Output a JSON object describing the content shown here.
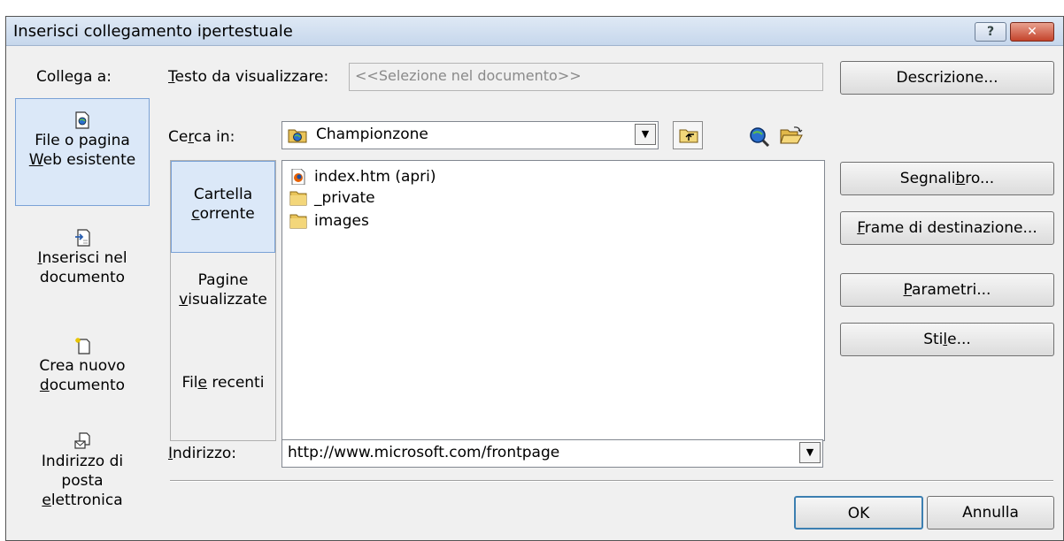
{
  "window": {
    "title": "Inserisci collegamento ipertestuale",
    "help_label": "?",
    "close_label": "✕"
  },
  "sidebar": {
    "heading": "Collega a:",
    "items": [
      {
        "line1": "File o pagina",
        "line2": "Web esistente",
        "line3": "",
        "icon": "web-page-icon",
        "active": true
      },
      {
        "line1": "Inserisci nel",
        "line2": "documento",
        "line3": "",
        "icon": "place-in-document-icon",
        "active": false
      },
      {
        "line1": "Crea nuovo",
        "line2": "documento",
        "line3": "",
        "icon": "new-document-icon",
        "active": false
      },
      {
        "line1": "Indirizzo di",
        "line2": "posta",
        "line3": "elettronica",
        "icon": "email-address-icon",
        "active": false
      }
    ]
  },
  "text_to_display": {
    "label": "Testo da visualizzare:",
    "value": "<<Selezione nel documento>>"
  },
  "look_in": {
    "label": "Cerca in:",
    "value": "Championzone"
  },
  "tabs": [
    {
      "line1": "Cartella",
      "line2": "corrente",
      "active": true
    },
    {
      "line1": "Pagine",
      "line2": "visualizzate",
      "active": false
    },
    {
      "line1": "File recenti",
      "line2": "",
      "active": false
    }
  ],
  "files": [
    {
      "name": "index.htm (apri)",
      "icon": "firefox-html-icon"
    },
    {
      "name": "_private",
      "icon": "folder-icon"
    },
    {
      "name": "images",
      "icon": "folder-icon"
    }
  ],
  "address": {
    "label": "Indirizzo:",
    "value": "http://www.microsoft.com/frontpage"
  },
  "buttons": {
    "description": "Descrizione...",
    "bookmark": "Segnalibro...",
    "target_frame": "Frame di destinazione...",
    "parameters": "Parametri...",
    "style": "Stile...",
    "ok": "OK",
    "cancel": "Annulla"
  }
}
